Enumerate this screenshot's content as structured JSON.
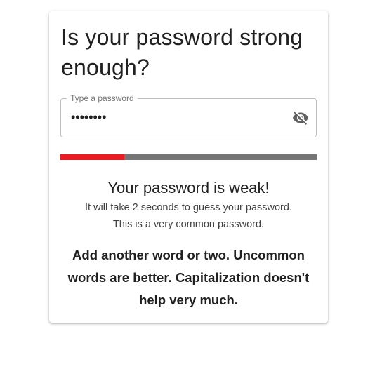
{
  "card": {
    "title": "Is your password strong enough?"
  },
  "password_field": {
    "label": "Type a password",
    "value": "••••••••",
    "toggle_icon": "eye-off-icon"
  },
  "strength_meter": {
    "level": 0.25,
    "fill_color": "#e81c24",
    "track_color": "#757575"
  },
  "result": {
    "verdict": "Your password is weak!",
    "crack_time": "It will take 2 seconds to guess your password.",
    "warning": "This is a very common password.",
    "suggestion": "Add another word or two. Uncommon words are better. Capitalization doesn't help very much."
  }
}
